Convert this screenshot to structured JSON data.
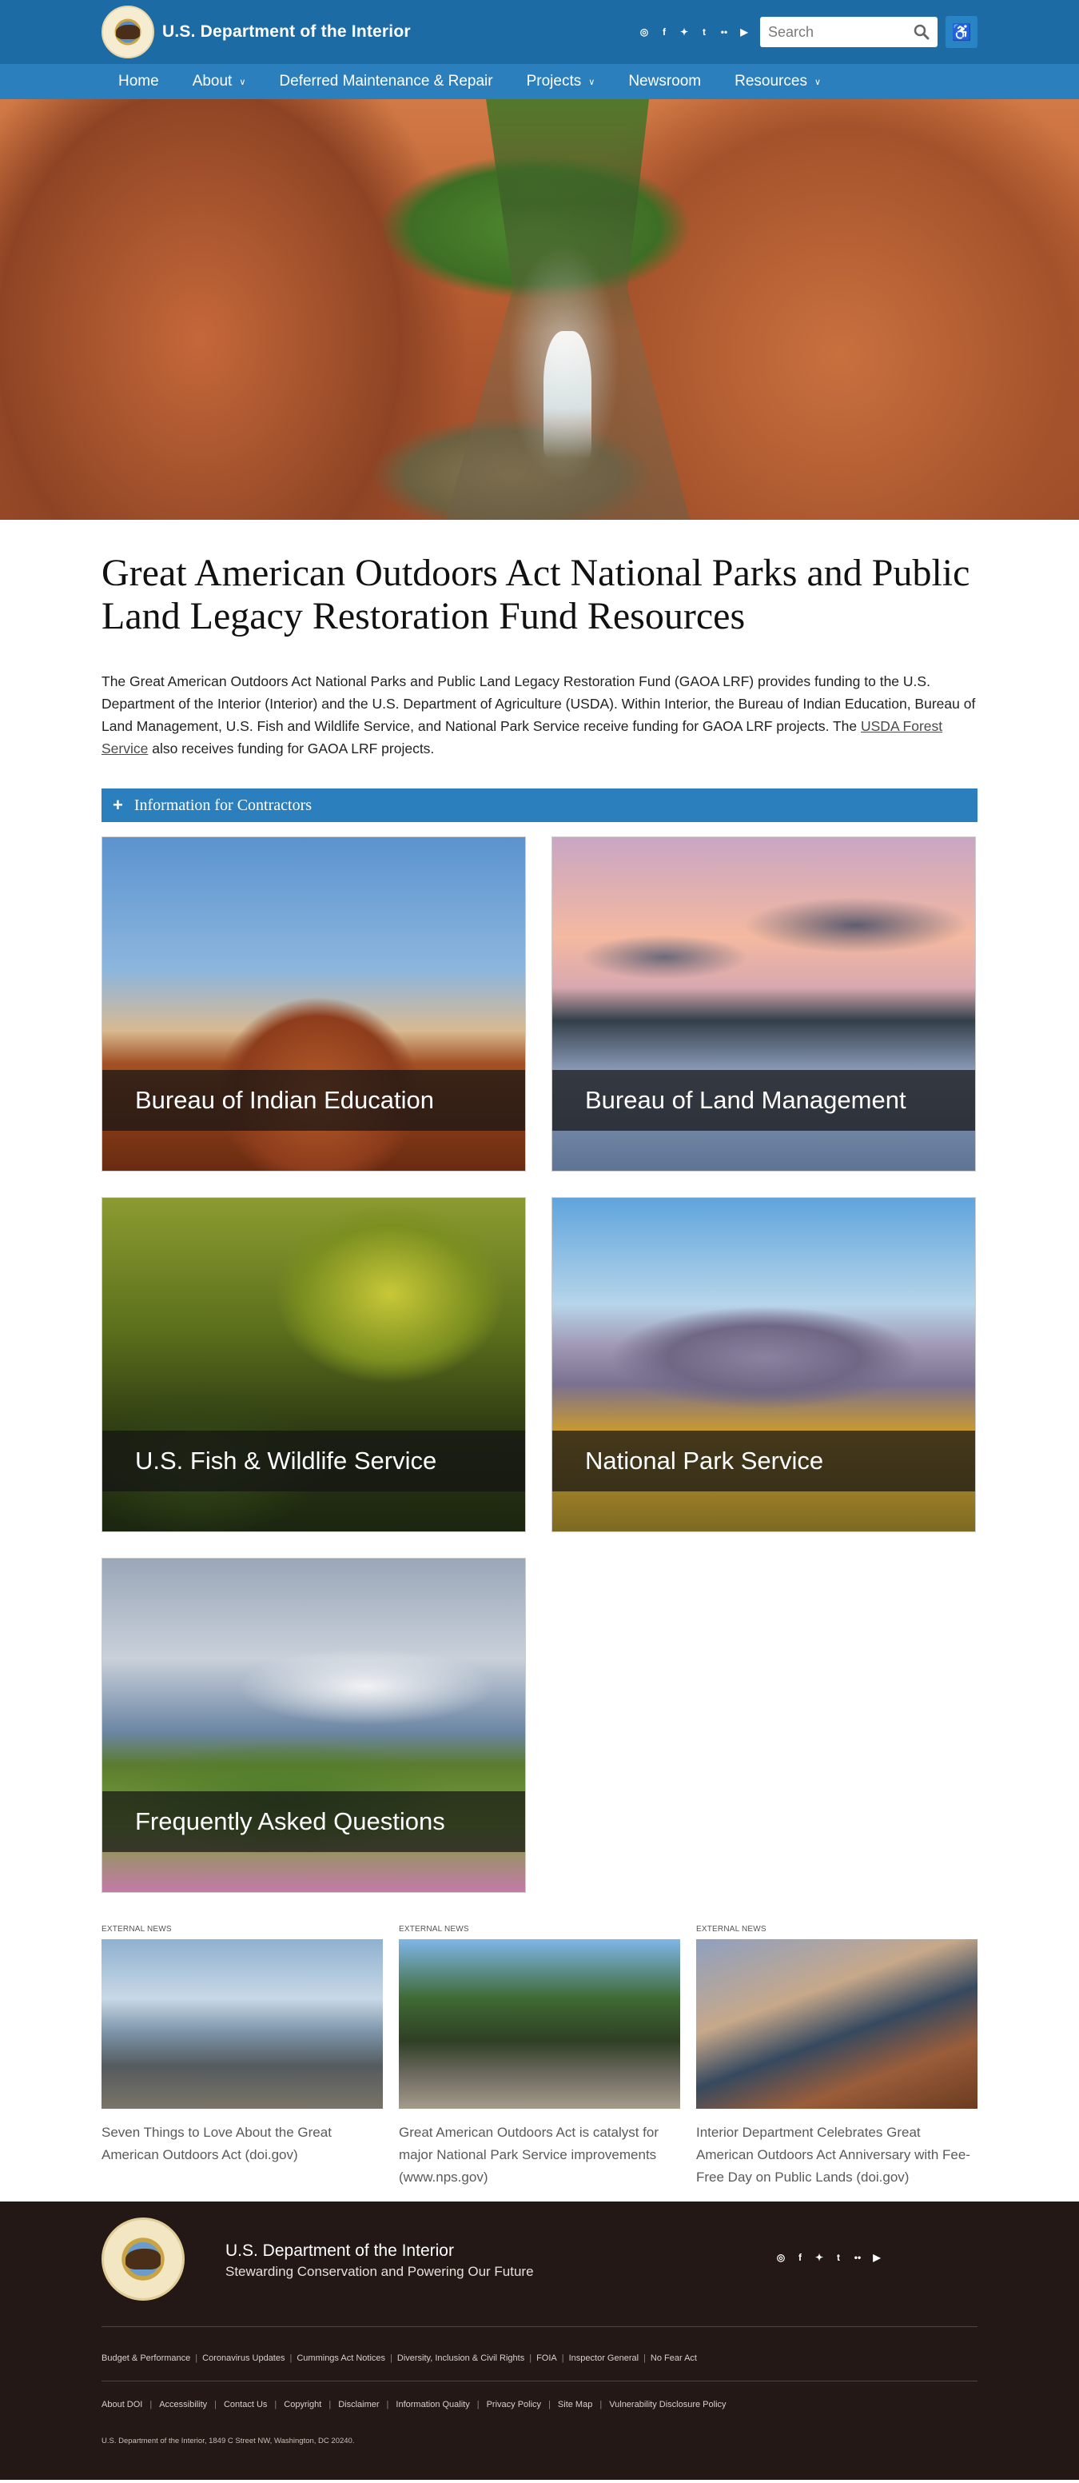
{
  "header": {
    "site_title": "U.S. Department of the Interior",
    "social_icons": [
      "instagram-icon",
      "facebook-icon",
      "twitter-icon",
      "tumblr-icon",
      "flickr-icon",
      "youtube-icon"
    ],
    "search_placeholder": "Search"
  },
  "nav": {
    "items": [
      {
        "label": "Home",
        "has_dropdown": false
      },
      {
        "label": "About",
        "has_dropdown": true
      },
      {
        "label": "Deferred Maintenance & Repair",
        "has_dropdown": false
      },
      {
        "label": "Projects",
        "has_dropdown": true
      },
      {
        "label": "Newsroom",
        "has_dropdown": false
      },
      {
        "label": "Resources",
        "has_dropdown": true
      }
    ]
  },
  "page": {
    "title": "Great American Outdoors Act National Parks and Public Land Legacy Restoration Fund Resources",
    "intro_text": "The Great American Outdoors Act National Parks and Public Land Legacy Restoration Fund (GAOA LRF) provides funding to the U.S. Department of the Interior (Interior) and the U.S. Department of Agriculture (USDA). Within Interior, the Bureau of Indian Education, Bureau of Land Management, U.S. Fish and Wildlife Service, and National Park Service receive funding for GAOA LRF projects. The ",
    "intro_link": "USDA Forest Service",
    "intro_tail": " also receives funding for GAOA LRF projects.",
    "accordion_label": "Information for Contractors"
  },
  "cards": [
    {
      "label": "Bureau of Indian Education"
    },
    {
      "label": "Bureau of Land Management"
    },
    {
      "label": "U.S. Fish & Wildlife Service"
    },
    {
      "label": "National Park Service"
    },
    {
      "label": "Frequently Asked Questions"
    }
  ],
  "news": [
    {
      "tag": "EXTERNAL NEWS",
      "title": "Seven Things to Love About the Great American Outdoors Act (doi.gov)"
    },
    {
      "tag": "EXTERNAL NEWS",
      "title": "Great American Outdoors Act is catalyst for major National Park Service improvements (www.nps.gov)"
    },
    {
      "tag": "EXTERNAL NEWS",
      "title": "Interior Department Celebrates Great American Outdoors Act Anniversary with Fee-Free Day on Public Lands (doi.gov)"
    }
  ],
  "footer": {
    "name": "U.S. Department of the Interior",
    "tagline": "Stewarding Conservation and Powering Our Future",
    "links_row1": [
      "Budget & Performance",
      "Coronavirus Updates",
      "Cummings Act Notices",
      "Diversity, Inclusion & Civil Rights",
      "FOIA",
      "Inspector General",
      "No Fear Act"
    ],
    "links_row2": [
      "About DOI",
      "Accessibility",
      "Contact Us",
      "Copyright",
      "Disclaimer",
      "Information Quality",
      "Privacy Policy",
      "Site Map",
      "Vulnerability Disclosure Policy"
    ],
    "address": "U.S. Department of the Interior, 1849 C Street NW, Washington, DC 20240."
  }
}
